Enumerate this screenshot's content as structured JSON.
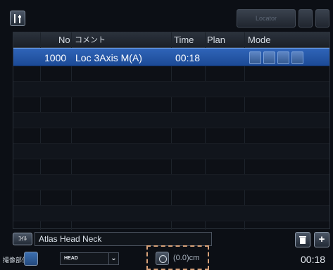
{
  "toolbar": {
    "tool_icon": "tool-settings-icon",
    "locator_label": "Locator"
  },
  "table": {
    "headers": [
      "No",
      "コメント",
      "Time",
      "Plan",
      "Mode"
    ],
    "rows": [
      {
        "no": "1000",
        "comment": "Loc 3Axis M(A)",
        "time": "00:18",
        "plan": "",
        "mode_icons": [
          "mode-icon-1",
          "mode-icon-2",
          "mode-icon-3",
          "mode-icon-4"
        ],
        "selected": true
      }
    ]
  },
  "coil": {
    "button_label": "ｺｲﾙ",
    "value": "Atlas Head Neck"
  },
  "body_part": {
    "label": "撮像部位",
    "selected": "HEAD"
  },
  "scan": {
    "value": "(0.0)cm"
  },
  "footer": {
    "total_time": "00:18"
  },
  "colors": {
    "selection": "#2f64b8",
    "background": "#0c0f15",
    "highlight_dash": "#d8a27a"
  }
}
